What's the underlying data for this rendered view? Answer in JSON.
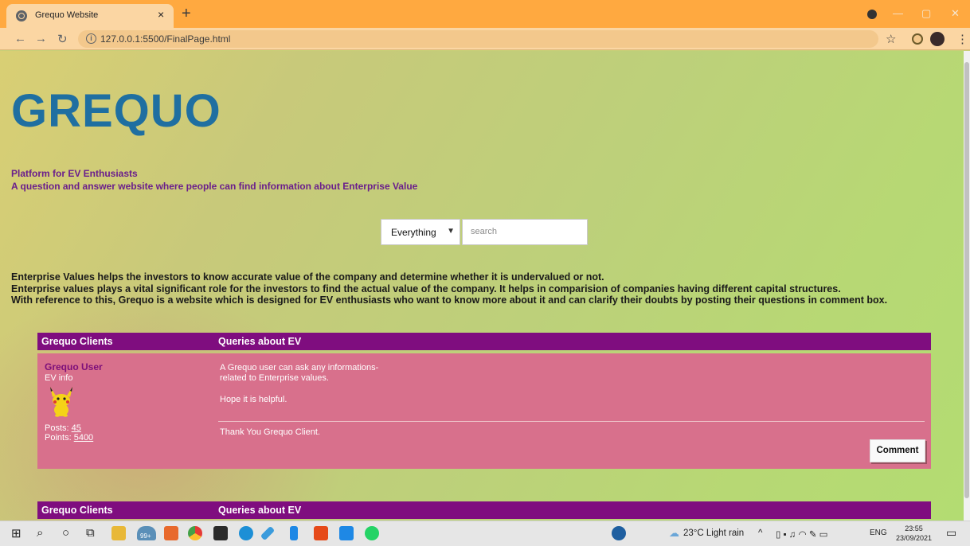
{
  "browser": {
    "tab_title": "Grequo Website",
    "tab_close": "×",
    "new_tab": "+",
    "url": "127.0.0.1:5500/FinalPage.html"
  },
  "site": {
    "logo": "GREQUO",
    "tagline_1": "Platform for EV Enthusiasts",
    "tagline_2": "A question and answer website where people can find information about Enterprise Value",
    "search": {
      "selected": "Everything",
      "placeholder": "search"
    },
    "description": [
      "Enterprise Values helps the investors to know accurate value of the company and determine whether it is undervalued or not.",
      "Enterprise values plays a vital significant role for the investors to find the actual value of the company. It helps in comparision of companies having different capital structures.",
      "With reference to this, Grequo is a website which is designed for EV enthusiasts who want to know more about it and can clarify their doubts by posting their questions in comment box."
    ]
  },
  "forum": {
    "col_left": "Grequo Clients",
    "col_right": "Queries about EV",
    "post": {
      "user_name": "Grequo User",
      "user_sub": "EV info",
      "posts_label": "Posts:",
      "posts_value": "45",
      "points_label": "Points:",
      "points_value": "5400",
      "msg_line1": "A Grequo user can ask any informations-",
      "msg_line2": "related to Enterprise values.",
      "msg_line3": "Hope it is helpful.",
      "msg_sign": "Thank You Grequo Client.",
      "comment_button": "Comment"
    }
  },
  "taskbar": {
    "badge": "99+",
    "weather": "23°C  Light rain",
    "language": "ENG",
    "time": "23:55",
    "date": "23/09/2021"
  }
}
